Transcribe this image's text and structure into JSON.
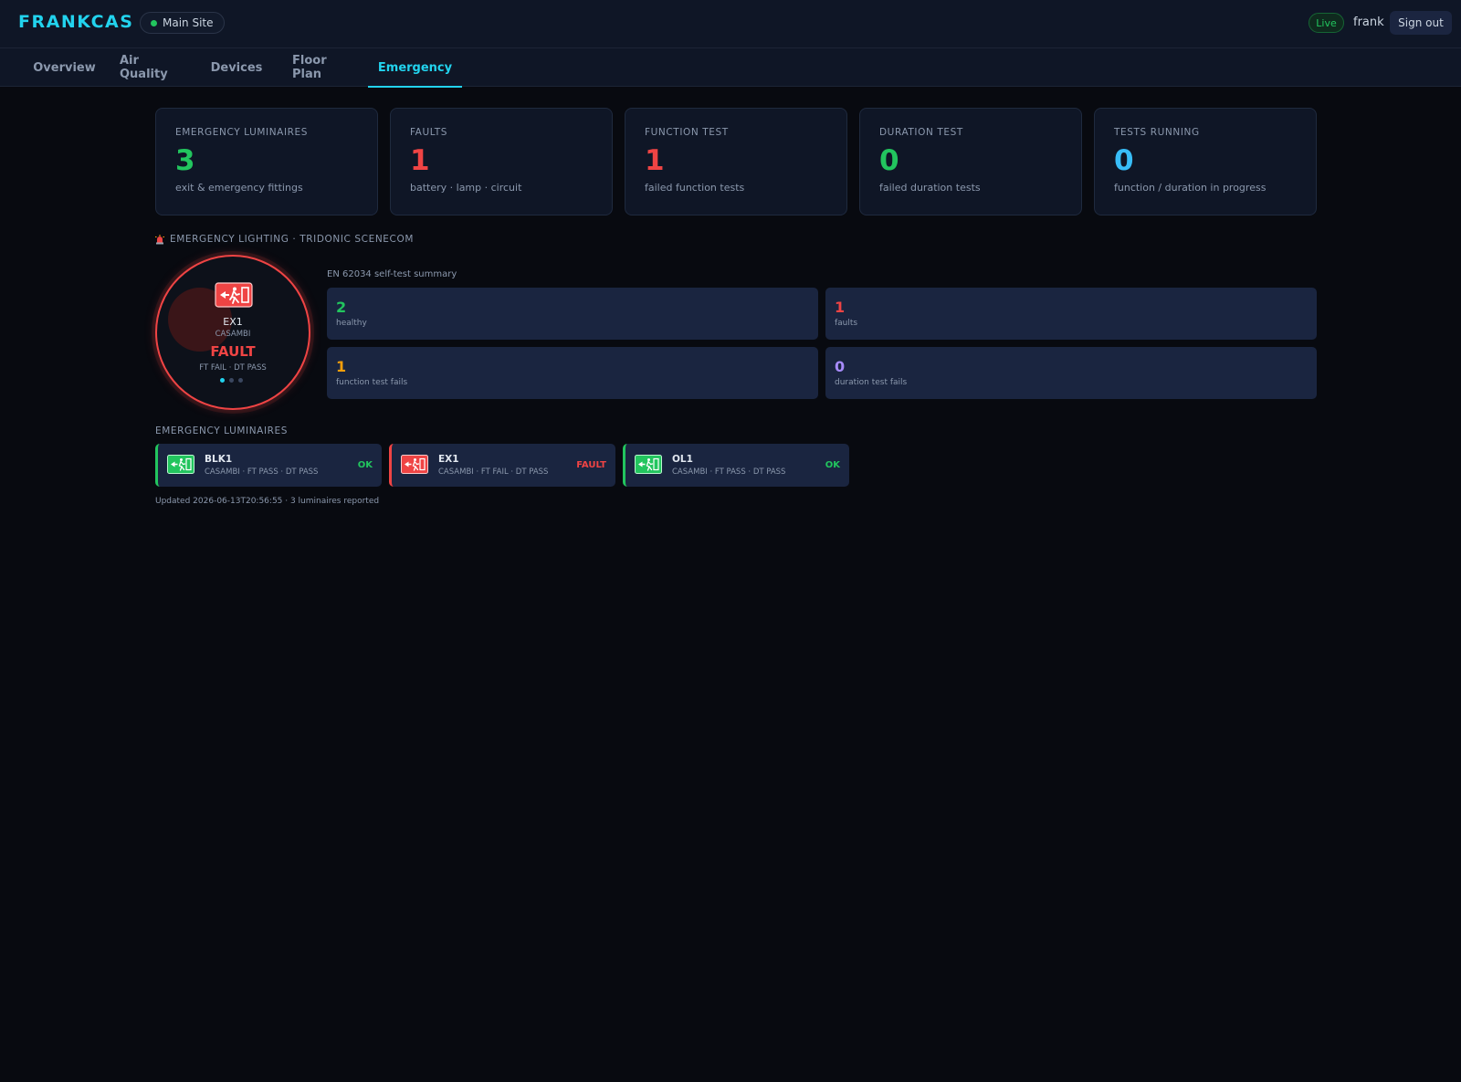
{
  "header": {
    "brand": "FRANKCAS",
    "site": "Main Site",
    "live": "Live",
    "user": "frank",
    "signout": "Sign out"
  },
  "tabs": [
    "Overview",
    "Air Quality",
    "Devices",
    "Floor Plan",
    "Emergency"
  ],
  "active_tab": "Emergency",
  "stats": [
    {
      "title": "EMERGENCY LUMINAIRES",
      "value": "3",
      "sub": "exit & emergency fittings",
      "color": "#22c55e"
    },
    {
      "title": "FAULTS",
      "value": "1",
      "sub": "battery · lamp · circuit",
      "color": "#ef4444"
    },
    {
      "title": "FUNCTION TEST",
      "value": "1",
      "sub": "failed function tests",
      "color": "#ef4444"
    },
    {
      "title": "DURATION TEST",
      "value": "0",
      "sub": "failed duration tests",
      "color": "#22c55e"
    },
    {
      "title": "TESTS RUNNING",
      "value": "0",
      "sub": "function / duration in progress",
      "color": "#38bdf8"
    }
  ],
  "section": {
    "title": "EMERGENCY LIGHTING · TRIDONIC SCENECOM",
    "icon": "siren-icon"
  },
  "hero": {
    "name": "EX1",
    "brand": "CASAMBI",
    "status": "FAULT",
    "tests": "FT FAIL · DT PASS",
    "icon": "exit-sign-icon",
    "color": "#ef4444"
  },
  "summary": {
    "label": "EN 62034 self-test summary",
    "items": [
      {
        "value": "2",
        "label": "healthy",
        "color": "#22c55e"
      },
      {
        "value": "1",
        "label": "faults",
        "color": "#ef4444"
      },
      {
        "value": "1",
        "label": "function test fails",
        "color": "#f59e0b"
      },
      {
        "value": "0",
        "label": "duration test fails",
        "color": "#a78bfa"
      }
    ]
  },
  "luminaires": {
    "title": "EMERGENCY LUMINAIRES",
    "items": [
      {
        "name": "BLK1",
        "meta": "CASAMBI · FT PASS · DT PASS",
        "status": "OK",
        "color": "#22c55e"
      },
      {
        "name": "EX1",
        "meta": "CASAMBI · FT FAIL · DT PASS",
        "status": "FAULT",
        "color": "#ef4444"
      },
      {
        "name": "OL1",
        "meta": "CASAMBI · FT PASS · DT PASS",
        "status": "OK",
        "color": "#22c55e"
      }
    ]
  },
  "updated": "Updated 2026-06-13T20:56:55 · 3 luminaires reported"
}
